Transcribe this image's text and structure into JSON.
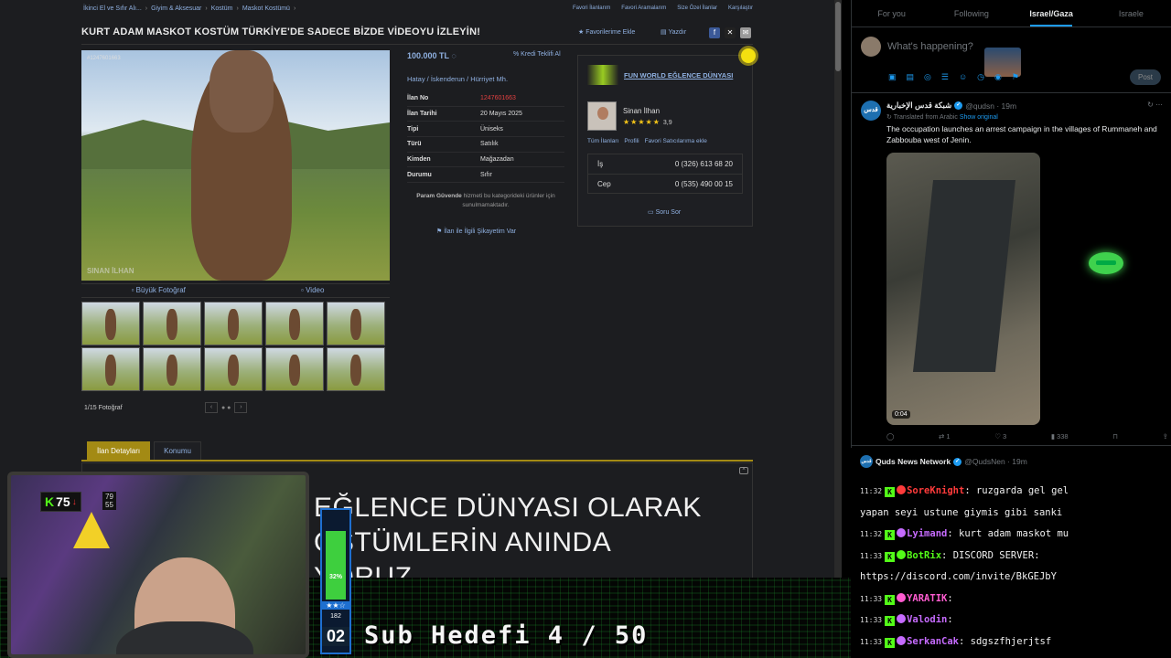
{
  "listing": {
    "breadcrumbs": [
      "İkinci El ve Sıfır Alı...",
      "Giyim & Aksesuar",
      "Kostüm",
      "Maskot Kostümü"
    ],
    "toplinks": [
      "Favori İlanlarım",
      "Favori Aramalarım",
      "Size Özel İlanlar",
      "Karşılaştır"
    ],
    "title": "KURT ADAM MASKOT KOSTÜM TÜRKİYE'DE SADECE BİZDE VİDEOYU İZLEYİN!",
    "favorite_label": "Favorilerime Ekle",
    "print_label": "Yazdır",
    "photo_id": "#1247601663",
    "watermark": "SINAN İLHAN",
    "photo_tab_big": "Büyük Fotoğraf",
    "photo_tab_video": "Video",
    "photo_count": "1/15 Fotoğraf",
    "price": "100.000 TL",
    "credit_label": "Kredi Teklifi Al",
    "location": "Hatay  /  İskenderun  /  Hürriyet Mh.",
    "details": [
      {
        "key": "İlan No",
        "value": "1247601663"
      },
      {
        "key": "İlan Tarihi",
        "value": "20 Mayıs 2025"
      },
      {
        "key": "Tipi",
        "value": "Üniseks"
      },
      {
        "key": "Türü",
        "value": "Satılık"
      },
      {
        "key": "Kimden",
        "value": "Mağazadan"
      },
      {
        "key": "Durumu",
        "value": "Sıfır"
      }
    ],
    "safe_pay_bold": "Param Güvende",
    "safe_pay_text": " hizmeti bu kategorideki ürünler için sunulmamaktadır.",
    "complaint_label": "İlan ile İlgili Şikayetim Var",
    "store_name": "FUN WORLD EĞLENCE DÜNYASI",
    "seller_name": "Sinan İlhan",
    "seller_rating": "3,9",
    "seller_links": [
      "Tüm İlanları",
      "Profili",
      "Favori Satıcılarıma ekle"
    ],
    "phone_work_label": "İş",
    "phone_work": "0 (326) 613 68 20",
    "phone_mobile_label": "Cep",
    "phone_mobile": "0 (535) 490 00 15",
    "ask_label": "Soru Sor",
    "tab_details": "İlan Detayları",
    "tab_location": "Konumu",
    "desc_line1": "EĞLENCE DÜNYASI OLARAK",
    "desc_line2": "OSTÜMLERİN ANINDA",
    "desc_line3": "YORUZ"
  },
  "twitter": {
    "tabs": [
      "For you",
      "Following",
      "Israel/Gaza",
      "Israele"
    ],
    "compose_placeholder": "What's happening?",
    "post_label": "Post",
    "tweet": {
      "avatar_text": "قدس",
      "name": "شبكة قدس الإخبارية",
      "handle": "@qudsn · 19m",
      "translated": "Translated from Arabic",
      "show_original": "Show original",
      "text": "The occupation launches an arrest campaign in the villages of Rummaneh and Zabbouba west of Jenin.",
      "duration": "0:04",
      "retweets": "1",
      "likes": "3",
      "views": "338"
    },
    "next_tweet": {
      "name": "Quds News Network",
      "handle": "@QudsNen · 19m"
    }
  },
  "chat": {
    "messages": [
      {
        "time": "11:32",
        "user": "SoreKnight",
        "color": "#ff3b3b",
        "text": "ruzgarda gel gel"
      },
      {
        "time": "",
        "user": "",
        "color": "",
        "text": "yapan seyi ustune giymis gibi sanki"
      },
      {
        "time": "11:32",
        "user": "Lyimand",
        "color": "#c66bff",
        "text": "kurt adam maskot mu"
      },
      {
        "time": "11:33",
        "user": "BotRix",
        "color": "#53fc18",
        "text": "DISCORD SERVER:"
      },
      {
        "time": "",
        "user": "",
        "color": "",
        "text": "https://discord.com/invite/BkGEJbY"
      },
      {
        "time": "11:33",
        "user": "YARATIK",
        "color": "#ff5cd0",
        "text": ""
      },
      {
        "time": "11:33",
        "user": "Valodin",
        "color": "#c66bff",
        "text": ""
      },
      {
        "time": "11:33",
        "user": "SerkanCak",
        "color": "#c66bff",
        "text": "sdgszfhjerjtsf"
      }
    ]
  },
  "overlay": {
    "kick_count": "75",
    "stat1": "79",
    "stat2": "55",
    "level_pct": "32%",
    "level_fraction": 0.32,
    "level_sub": "182",
    "level_big": "02",
    "sub_goal": "Sub Hedefi 4 / 50"
  },
  "colors": {
    "link": "#8fb0e0",
    "accent_gold": "#a38a14",
    "twitter_blue": "#1d9bf0",
    "kick_green": "#53fc18"
  }
}
